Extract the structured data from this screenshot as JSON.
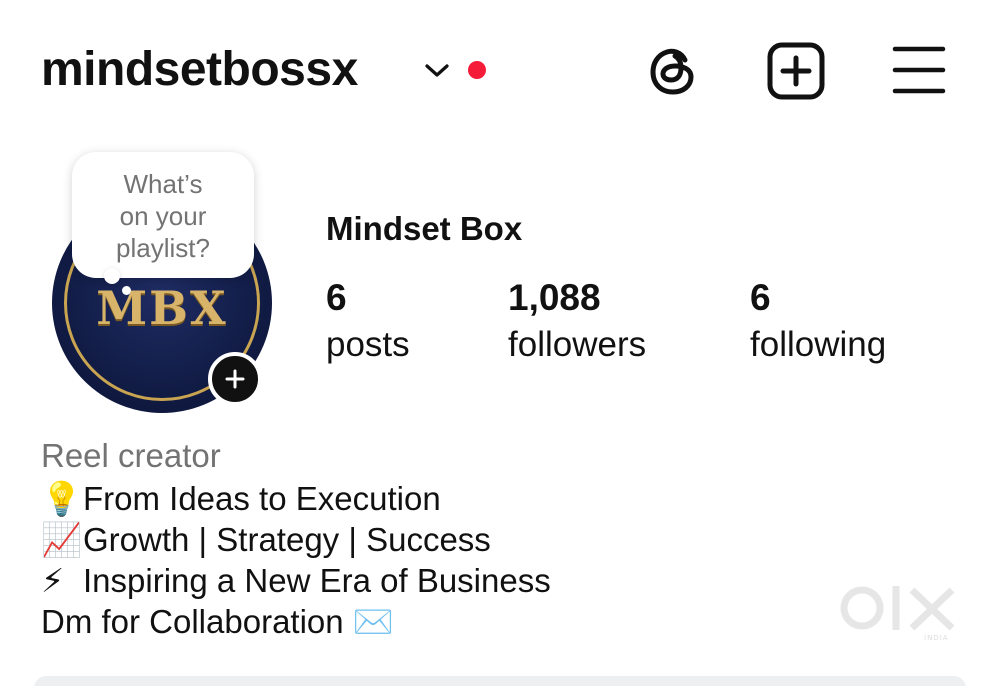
{
  "header": {
    "username": "mindsetbossx",
    "icons": [
      "chevron-down-icon",
      "notification-dot",
      "threads-icon",
      "new-post-icon",
      "menu-icon"
    ],
    "notification_color": "#f51c3a"
  },
  "profile": {
    "avatar_logo": "MBX",
    "note": "What’s\non your\nplaylist?",
    "display_name": "Mindset Box",
    "stats": {
      "posts_count": "6",
      "posts_label": "posts",
      "followers_count": "1,088",
      "followers_label": "followers",
      "following_count": "6",
      "following_label": "following"
    }
  },
  "bio": {
    "category": "Reel creator",
    "lines": [
      {
        "emoji": "💡",
        "text": "From Ideas to Execution"
      },
      {
        "emoji": "📈",
        "text": "Growth | Strategy | Success"
      },
      {
        "emoji": "⚡",
        "text": "Inspiring a New Era of Business"
      },
      {
        "text": "Dm for Collaboration",
        "emoji": "✉️"
      }
    ]
  },
  "watermark": {
    "brand": "OLX",
    "sub": "INDIA"
  }
}
